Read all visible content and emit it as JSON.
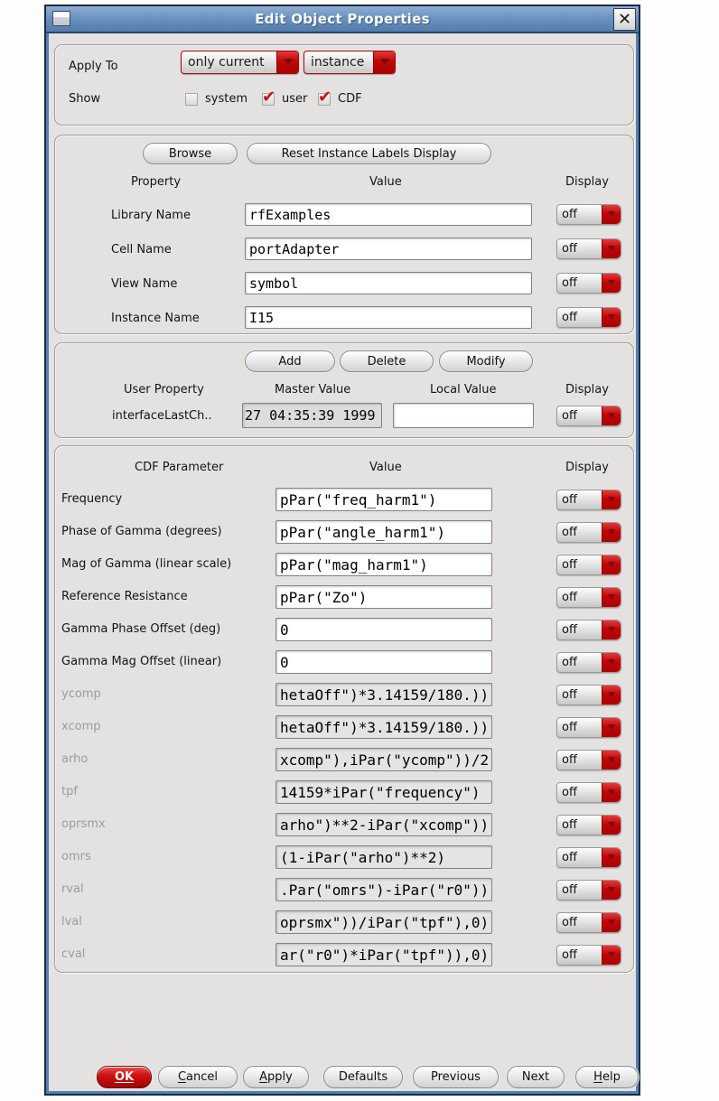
{
  "window": {
    "title": "Edit Object Properties"
  },
  "colors": {
    "accent_red": "#c90f0f",
    "titlebar_blue": "#6b93c1"
  },
  "apply_section": {
    "apply_to_label": "Apply To",
    "scope_value": "only current",
    "target_value": "instance",
    "show_label": "Show",
    "checkboxes": [
      {
        "label": "system",
        "checked": false
      },
      {
        "label": "user",
        "checked": true
      },
      {
        "label": "CDF",
        "checked": true
      }
    ]
  },
  "instance_section": {
    "browse_label": "Browse",
    "reset_label": "Reset Instance Labels Display",
    "headers": {
      "property": "Property",
      "value": "Value",
      "display": "Display"
    },
    "rows": [
      {
        "property": "Library Name",
        "value": "rfExamples",
        "display": "off"
      },
      {
        "property": "Cell Name",
        "value": "portAdapter",
        "display": "off"
      },
      {
        "property": "View Name",
        "value": "symbol",
        "display": "off"
      },
      {
        "property": "Instance Name",
        "value": "I15",
        "display": "off"
      }
    ]
  },
  "user_property_section": {
    "add_label": "Add",
    "delete_label": "Delete",
    "modify_label": "Modify",
    "headers": {
      "property": "User Property",
      "master": "Master Value",
      "local": "Local Value",
      "display": "Display"
    },
    "rows": [
      {
        "property": "interfaceLastCh..",
        "master_value": "27 04:35:39 1999",
        "local_value": "",
        "display": "off"
      }
    ]
  },
  "cdf_section": {
    "headers": {
      "parameter": "CDF Parameter",
      "value": "Value",
      "display": "Display"
    },
    "rows": [
      {
        "parameter": "Frequency",
        "value": "pPar(\"freq_harm1\")",
        "display": "off",
        "disabled": false
      },
      {
        "parameter": "Phase of Gamma (degrees)",
        "value": "pPar(\"angle_harm1\")",
        "display": "off",
        "disabled": false
      },
      {
        "parameter": "Mag of Gamma (linear scale)",
        "value": "pPar(\"mag_harm1\")",
        "display": "off",
        "disabled": false
      },
      {
        "parameter": "Reference Resistance",
        "value": "pPar(\"Zo\")",
        "display": "off",
        "disabled": false
      },
      {
        "parameter": "Gamma Phase Offset (deg)",
        "value": "0",
        "display": "off",
        "disabled": false
      },
      {
        "parameter": "Gamma Mag Offset (linear)",
        "value": "0",
        "display": "off",
        "disabled": false
      },
      {
        "parameter": "ycomp",
        "value": "hetaOff\")*3.14159/180.))",
        "display": "off",
        "disabled": true
      },
      {
        "parameter": "xcomp",
        "value": "hetaOff\")*3.14159/180.))",
        "display": "off",
        "disabled": true
      },
      {
        "parameter": "arho",
        "value": "xcomp\"),iPar(\"ycomp\"))/2",
        "display": "off",
        "disabled": true
      },
      {
        "parameter": "tpf",
        "value": "14159*iPar(\"frequency\")",
        "display": "off",
        "disabled": true
      },
      {
        "parameter": "oprsmx",
        "value": "arho\")**2-iPar(\"xcomp\"))",
        "display": "off",
        "disabled": true
      },
      {
        "parameter": "omrs",
        "value": "(1-iPar(\"arho\")**2)",
        "display": "off",
        "disabled": true
      },
      {
        "parameter": "rval",
        "value": ".Par(\"omrs\")-iPar(\"r0\"))",
        "display": "off",
        "disabled": true
      },
      {
        "parameter": "lval",
        "value": "oprsmx\"))/iPar(\"tpf\"),0)",
        "display": "off",
        "disabled": true
      },
      {
        "parameter": "cval",
        "value": "ar(\"r0\")*iPar(\"tpf\")),0)",
        "display": "off",
        "disabled": true
      }
    ]
  },
  "footer": {
    "buttons": [
      {
        "label": "OK",
        "mnemonic": "OK"
      },
      {
        "label": "Cancel",
        "mnemonic": "C"
      },
      {
        "label": "Apply",
        "mnemonic": "A"
      },
      {
        "label": "Defaults"
      },
      {
        "label": "Previous"
      },
      {
        "label": "Next"
      },
      {
        "label": "Help",
        "mnemonic": "H"
      }
    ]
  }
}
